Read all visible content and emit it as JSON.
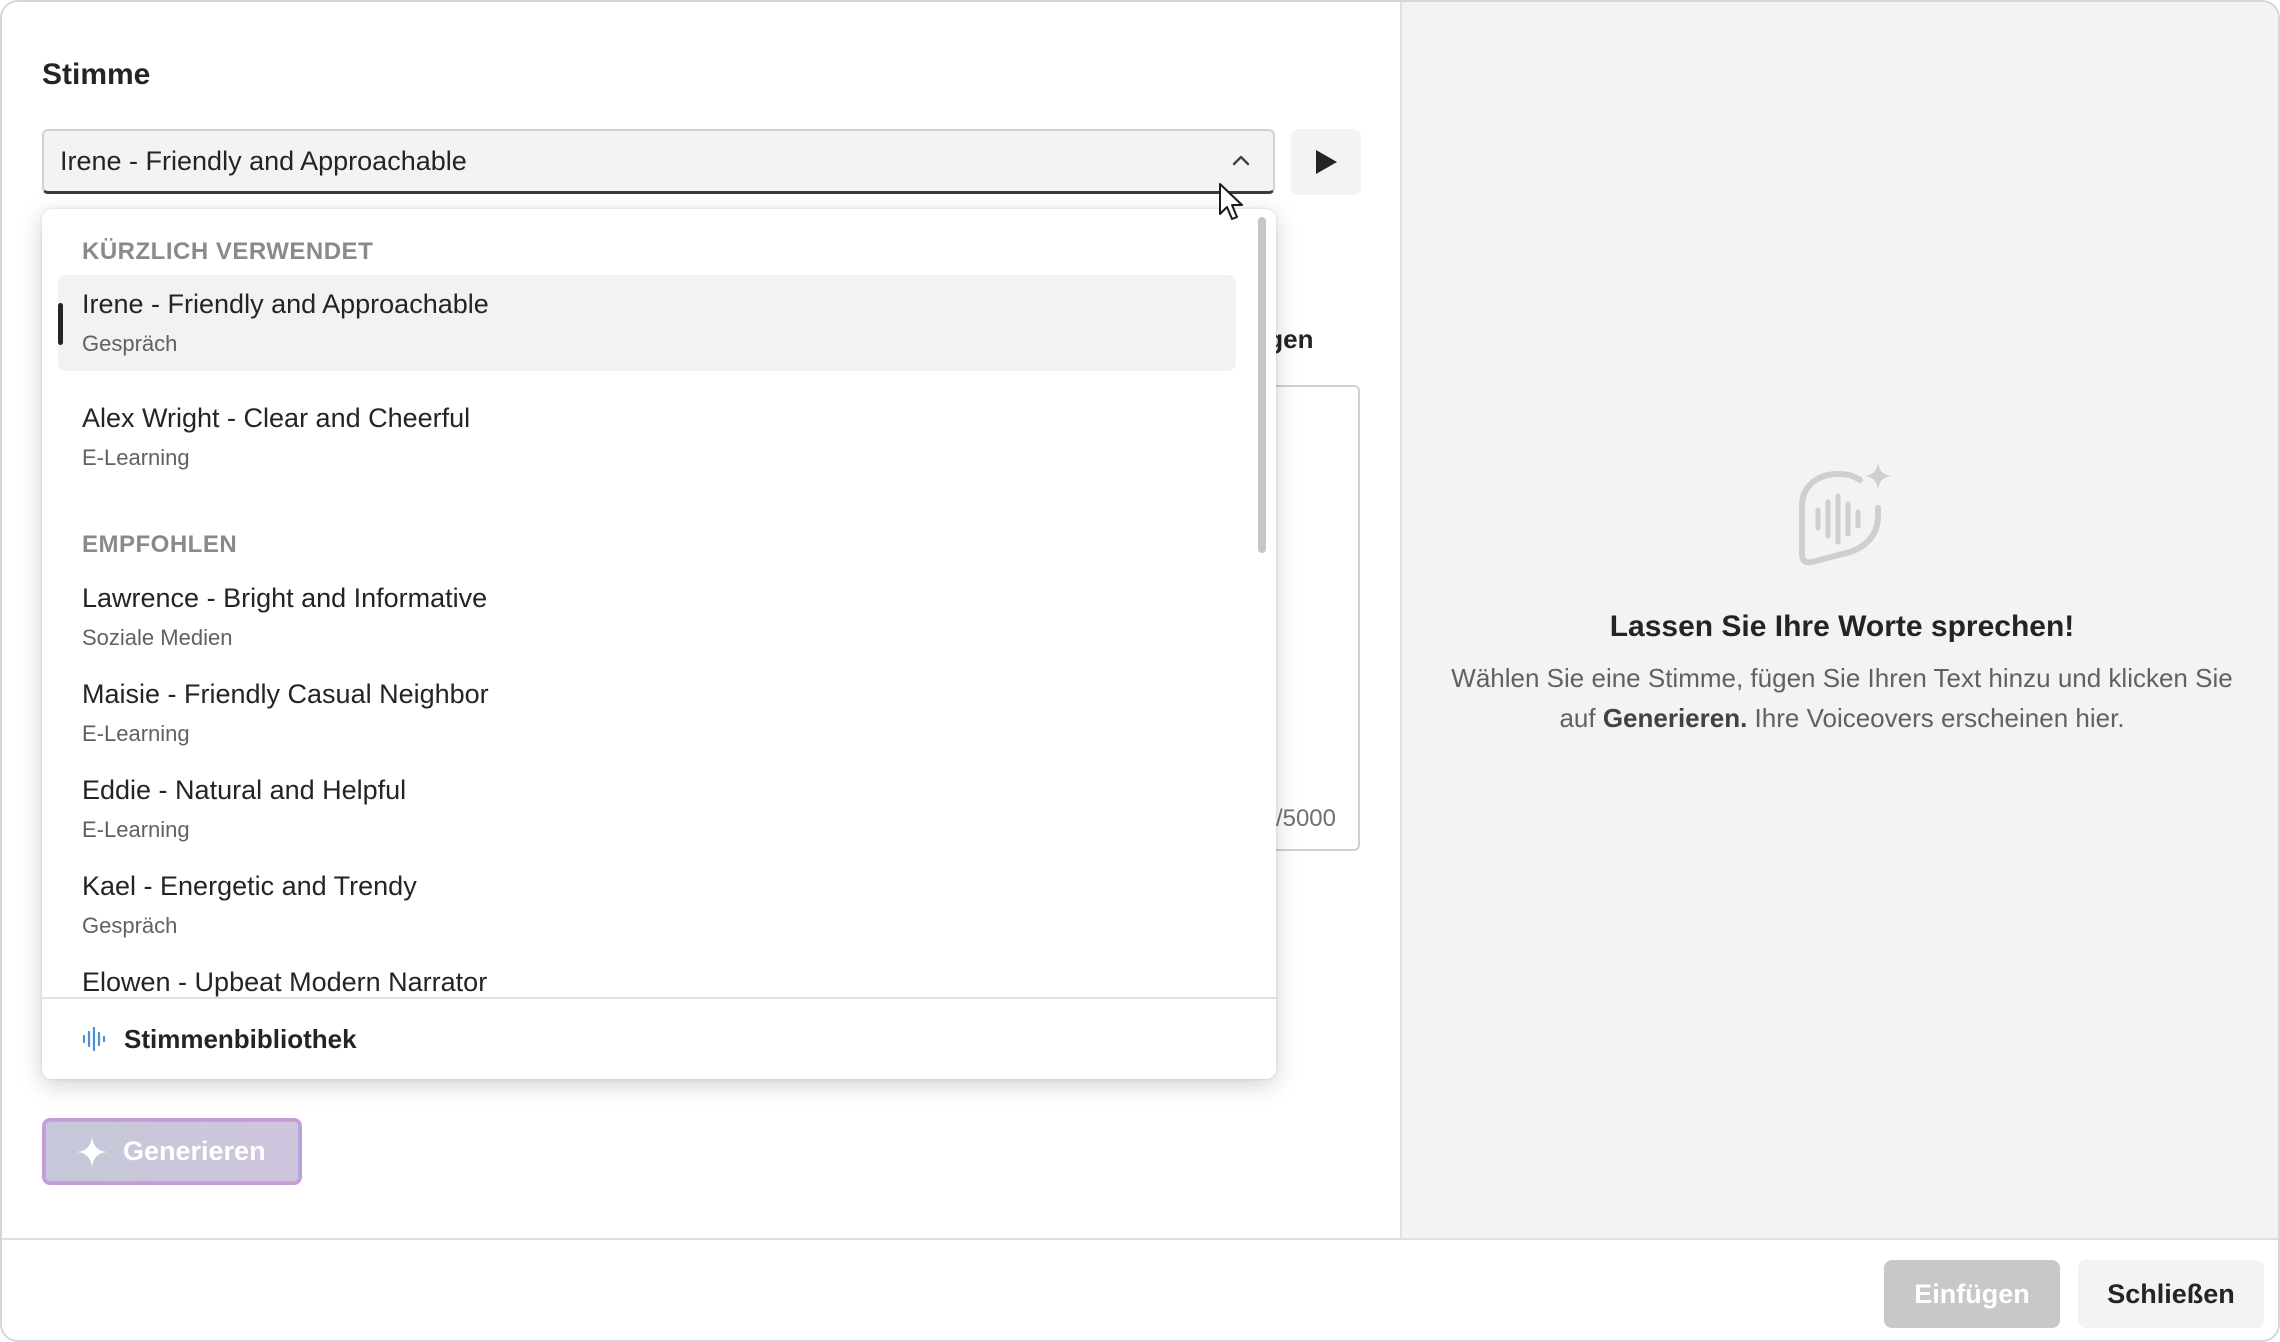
{
  "voice": {
    "heading": "Stimme",
    "selected_value": "Irene - Friendly and Approachable"
  },
  "dropdown": {
    "groups": [
      {
        "label": "KÜRZLICH VERWENDET"
      },
      {
        "label": "EMPFOHLEN"
      }
    ],
    "options": [
      {
        "title": "Irene - Friendly and Approachable",
        "subtitle": "Gespräch",
        "selected": true
      },
      {
        "title": "Alex Wright - Clear and Cheerful",
        "subtitle": "E-Learning"
      },
      {
        "title": "Lawrence - Bright and Informative",
        "subtitle": "Soziale Medien"
      },
      {
        "title": "Maisie - Friendly Casual Neighbor",
        "subtitle": "E-Learning"
      },
      {
        "title": "Eddie - Natural and Helpful",
        "subtitle": "E-Learning"
      },
      {
        "title": "Kael - Energetic and Trendy",
        "subtitle": "Gespräch"
      },
      {
        "title": "Elowen - Upbeat Modern Narrator",
        "subtitle": ""
      }
    ],
    "footer_label": "Stimmenbibliothek"
  },
  "script": {
    "partial_label": "igen",
    "char_count_partial": "/5000"
  },
  "generate_label": "Generieren",
  "empty_state": {
    "title": "Lassen Sie Ihre Worte sprechen!",
    "desc_part1": "Wählen Sie eine Stimme, fügen Sie Ihren Text hinzu und klicken Sie auf ",
    "desc_bold": "Generieren.",
    "desc_part2": " Ihre Voiceovers erscheinen hier."
  },
  "footer": {
    "insert_label": "Einfügen",
    "close_label": "Schließen"
  },
  "colors": {
    "accent_border": "#c79bd6",
    "selected_bg": "#f2f2f2",
    "icon_blue": "#4a8fd8"
  },
  "icons": [
    "chevron-up-icon",
    "play-icon",
    "waveform-icon",
    "sparkle-icon",
    "voice-sparkle-icon"
  ]
}
